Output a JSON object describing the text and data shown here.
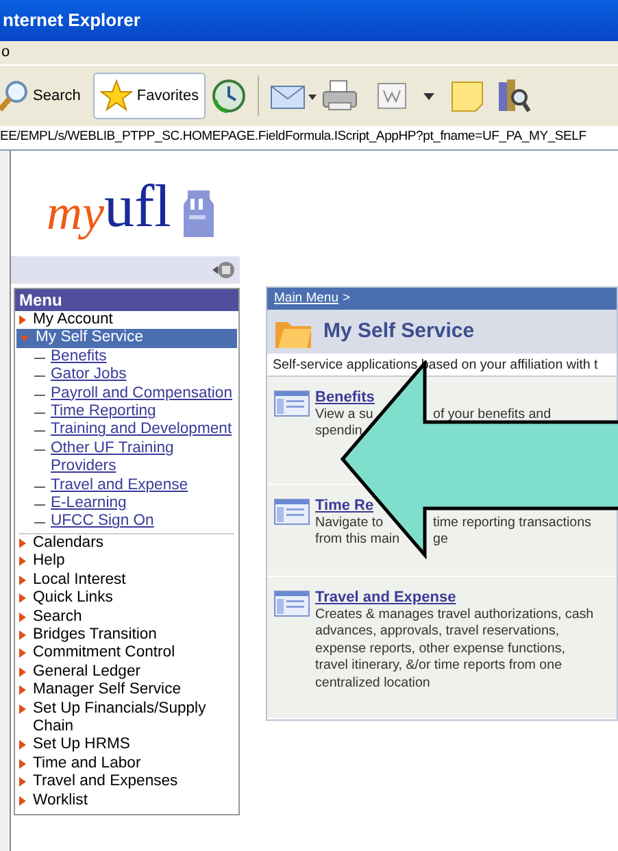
{
  "window": {
    "title": "nternet Explorer"
  },
  "menu_bar": [
    "o"
  ],
  "toolbar": [
    {
      "label": "Search",
      "selected": false
    },
    {
      "label": "Favorites",
      "selected": true
    }
  ],
  "address": "EE/EMPL/s/WEBLIB_PTPP_SC.HOMEPAGE.FieldFormula.IScript_AppHP?pt_fname=UF_PA_MY_SELF",
  "logo": {
    "prefix": "my",
    "name": "ufl"
  },
  "menu": {
    "title": "Menu",
    "items": [
      {
        "label": "My Account",
        "expanded": false,
        "selected": false
      },
      {
        "label": "My Self Service",
        "expanded": true,
        "selected": true,
        "children": [
          "Benefits",
          "Gator Jobs",
          "Payroll and Compensation",
          "Time Reporting",
          "Training and Development",
          "Other UF Training Providers",
          "Travel and Expense",
          "E-Learning",
          "UFCC Sign On"
        ]
      },
      {
        "label": "Calendars",
        "expanded": false,
        "selected": false
      },
      {
        "label": "Help",
        "expanded": false,
        "selected": false
      },
      {
        "label": "Local Interest",
        "expanded": false,
        "selected": false
      },
      {
        "label": "Quick Links",
        "expanded": false,
        "selected": false
      },
      {
        "label": "Search",
        "expanded": false,
        "selected": false
      },
      {
        "label": "Bridges Transition",
        "expanded": false,
        "selected": false
      },
      {
        "label": "Commitment Control",
        "expanded": false,
        "selected": false
      },
      {
        "label": "General Ledger",
        "expanded": false,
        "selected": false
      },
      {
        "label": "Manager Self Service",
        "expanded": false,
        "selected": false
      },
      {
        "label": "Set Up Financials/Supply Chain",
        "expanded": false,
        "selected": false
      },
      {
        "label": "Set Up HRMS",
        "expanded": false,
        "selected": false
      },
      {
        "label": "Time and Labor",
        "expanded": false,
        "selected": false
      },
      {
        "label": "Travel and Expenses",
        "expanded": false,
        "selected": false
      },
      {
        "label": "Worklist",
        "expanded": false,
        "selected": false
      }
    ]
  },
  "content": {
    "breadcrumb": "Main Menu",
    "breadcrumb_separator": ">",
    "title": "My Self Service",
    "intro": "Self-service applications based on your affiliation with t",
    "tiles": [
      {
        "title": "Benefits",
        "lines": [
          [
            "View a su",
            "of your benefits and"
          ],
          [
            "spendin"
          ]
        ]
      },
      {
        "title": "Time Re",
        "lines": [
          [
            "Navigate to",
            "time reporting transactions"
          ],
          [
            "from this main",
            "ge"
          ]
        ]
      },
      {
        "title": "Travel and Expense",
        "lines": [
          [
            "Creates & manages travel authorizations, cash"
          ],
          [
            "advances, approvals, travel reservations,"
          ],
          [
            "expense reports, other expense functions,"
          ],
          [
            "travel itinerary, &/or time reports from one"
          ],
          [
            "centralized location"
          ]
        ]
      }
    ]
  }
}
